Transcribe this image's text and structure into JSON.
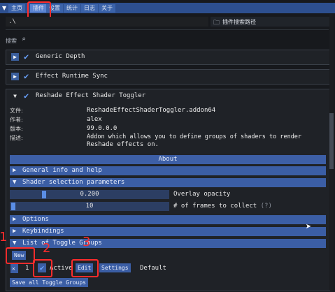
{
  "tabs": [
    "主页",
    "插件",
    "设置",
    "统计",
    "日志",
    "关于"
  ],
  "active_tab_index": 1,
  "path_value": ".\\",
  "search_button_label": "插件搜索路径",
  "search_label": "搜索",
  "plugins": [
    {
      "name": "Generic Depth"
    },
    {
      "name": "Effect Runtime Sync"
    },
    {
      "name": "Reshade Effect Shader Toggler"
    }
  ],
  "shader_info": {
    "file_key": "文件:",
    "file_value": "ReshadeEffectShaderToggler.addon64",
    "author_key": "作者:",
    "author_value": "alex",
    "version_key": "版本:",
    "version_value": "99.0.0.0",
    "desc_key": "描述:",
    "desc_line1": "Addon which allows you to define groups of shaders to render",
    "desc_line2": "Reshade effects on."
  },
  "about_label": "About",
  "sections": {
    "general": "General info and help",
    "selection": "Shader selection parameters",
    "options": "Options",
    "keybindings": "Keybindings",
    "toggle_groups": "List of Toggle Groups"
  },
  "sliders": [
    {
      "value_text": "0.200",
      "label": "Overlay opacity",
      "value": 0.2
    },
    {
      "value_text": "10",
      "label": "# of frames to collect",
      "help": "(?)",
      "value": 0.0
    }
  ],
  "buttons": {
    "new": "New",
    "edit": "Edit",
    "settings": "Settings",
    "save_all": "Save all Toggle Groups"
  },
  "group_row": {
    "delete_glyph": "✕",
    "index": "1",
    "active_label": "Active",
    "default_label": "Default"
  },
  "annotation_numbers": [
    "1",
    "2",
    "3"
  ],
  "colors": {
    "accent": "#3b5ea5",
    "annotation": "#ff2c2c",
    "check": "#6aa3ff"
  }
}
